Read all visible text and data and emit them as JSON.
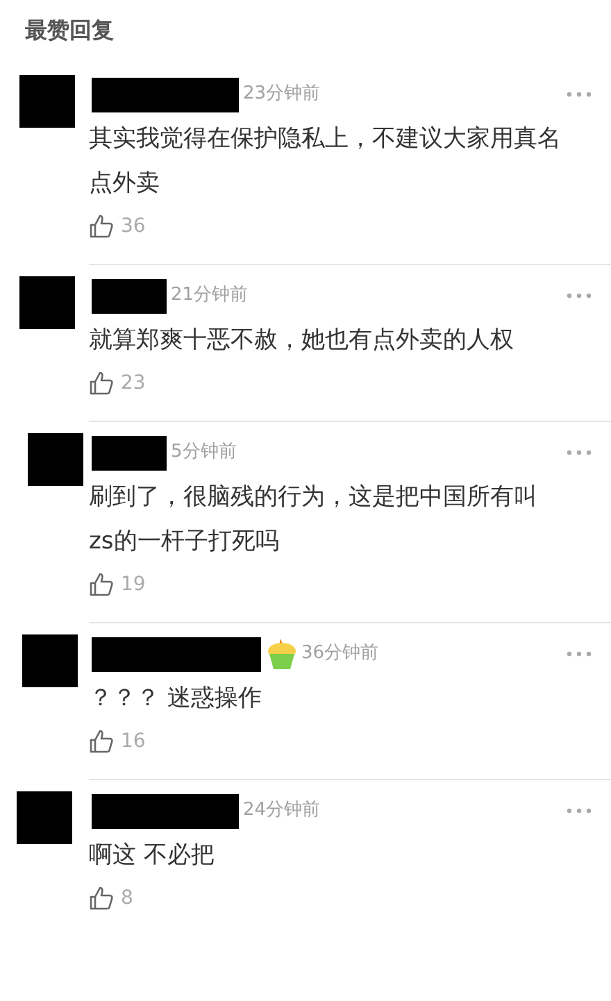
{
  "section_title": "最赞回复",
  "comments": [
    {
      "time": "23分钟前",
      "text": "其实我觉得在保护隐私上，不建议大家用真名点外卖",
      "likes": "36",
      "badge": false
    },
    {
      "time": "21分钟前",
      "text": "就算郑爽十恶不赦，她也有点外卖的人权",
      "likes": "23",
      "badge": false
    },
    {
      "time": "5分钟前",
      "text": "刷到了，很脑残的行为，这是把中国所有叫zs的一杆子打死吗",
      "likes": "19",
      "badge": false
    },
    {
      "time": "36分钟前",
      "text": "？？？ 迷惑操作",
      "likes": "16",
      "badge": true
    },
    {
      "time": "24分钟前",
      "text": "啊这 不必把",
      "likes": "8",
      "badge": false
    }
  ]
}
